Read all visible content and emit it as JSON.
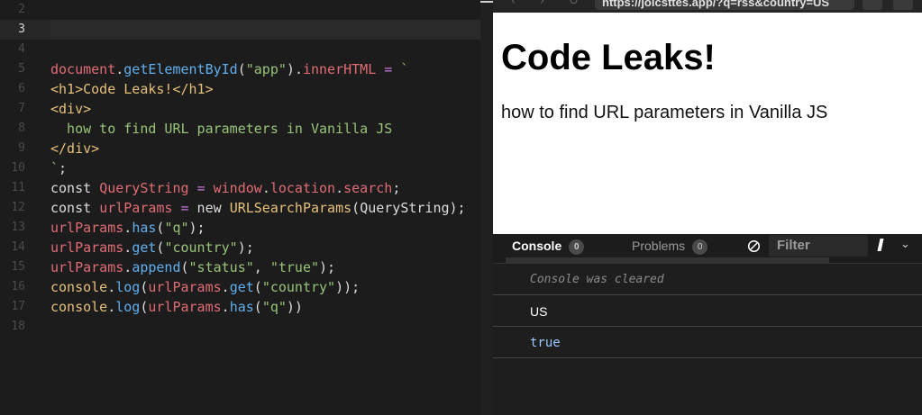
{
  "editor": {
    "lines": [
      {
        "num": "2",
        "tokens": []
      },
      {
        "num": "3",
        "tokens": [],
        "active": true
      },
      {
        "num": "4",
        "tokens": []
      },
      {
        "num": "5",
        "tokens": [
          [
            "t-obj",
            "document"
          ],
          [
            "t-dot",
            "."
          ],
          [
            "t-method",
            "getElementById"
          ],
          [
            "t-punc",
            "("
          ],
          [
            "t-str",
            "\"app\""
          ],
          [
            "t-punc",
            ")"
          ],
          [
            "t-dot",
            "."
          ],
          [
            "t-prop",
            "innerHTML"
          ],
          [
            "t-plain",
            " "
          ],
          [
            "t-op",
            "="
          ],
          [
            "t-plain",
            " "
          ],
          [
            "t-tpl",
            "`"
          ]
        ]
      },
      {
        "num": "6",
        "tokens": [
          [
            "t-tag",
            "<h1>Code Leaks!</h1>"
          ]
        ]
      },
      {
        "num": "7",
        "tokens": [
          [
            "t-tag",
            "<div>"
          ]
        ]
      },
      {
        "num": "8",
        "tokens": [
          [
            "t-tpl",
            "  how to find URL parameters in Vanilla JS"
          ]
        ]
      },
      {
        "num": "9",
        "tokens": [
          [
            "t-tag",
            "</div>"
          ]
        ]
      },
      {
        "num": "10",
        "tokens": [
          [
            "t-tpl",
            "`"
          ],
          [
            "t-punc",
            ";"
          ]
        ]
      },
      {
        "num": "11",
        "tokens": [
          [
            "t-kw",
            "const "
          ],
          [
            "t-var",
            "QueryString"
          ],
          [
            "t-plain",
            " "
          ],
          [
            "t-op",
            "="
          ],
          [
            "t-plain",
            " "
          ],
          [
            "t-obj",
            "window"
          ],
          [
            "t-dot",
            "."
          ],
          [
            "t-obj",
            "location"
          ],
          [
            "t-dot",
            "."
          ],
          [
            "t-obj",
            "search"
          ],
          [
            "t-punc",
            ";"
          ]
        ]
      },
      {
        "num": "12",
        "tokens": [
          [
            "t-kw",
            "const "
          ],
          [
            "t-var",
            "urlParams"
          ],
          [
            "t-plain",
            " "
          ],
          [
            "t-op",
            "="
          ],
          [
            "t-plain",
            " new "
          ],
          [
            "t-cls",
            "URLSearchParams"
          ],
          [
            "t-punc",
            "("
          ],
          [
            "t-plain",
            "QueryString"
          ],
          [
            "t-punc",
            ");"
          ]
        ]
      },
      {
        "num": "13",
        "tokens": [
          [
            "t-var",
            "urlParams"
          ],
          [
            "t-dot",
            "."
          ],
          [
            "t-method",
            "has"
          ],
          [
            "t-punc",
            "("
          ],
          [
            "t-str",
            "\"q\""
          ],
          [
            "t-punc",
            ");"
          ]
        ]
      },
      {
        "num": "14",
        "tokens": [
          [
            "t-var",
            "urlParams"
          ],
          [
            "t-dot",
            "."
          ],
          [
            "t-method",
            "get"
          ],
          [
            "t-punc",
            "("
          ],
          [
            "t-str",
            "\"country\""
          ],
          [
            "t-punc",
            ");"
          ]
        ]
      },
      {
        "num": "15",
        "tokens": [
          [
            "t-var",
            "urlParams"
          ],
          [
            "t-dot",
            "."
          ],
          [
            "t-method",
            "append"
          ],
          [
            "t-punc",
            "("
          ],
          [
            "t-str",
            "\"status\""
          ],
          [
            "t-punc",
            ", "
          ],
          [
            "t-str",
            "\"true\""
          ],
          [
            "t-punc",
            ");"
          ]
        ]
      },
      {
        "num": "16",
        "tokens": [
          [
            "t-con",
            "console"
          ],
          [
            "t-dot",
            "."
          ],
          [
            "t-method",
            "log"
          ],
          [
            "t-punc",
            "("
          ],
          [
            "t-var",
            "urlParams"
          ],
          [
            "t-dot",
            "."
          ],
          [
            "t-method",
            "get"
          ],
          [
            "t-punc",
            "("
          ],
          [
            "t-str",
            "\"country\""
          ],
          [
            "t-punc",
            "));"
          ]
        ]
      },
      {
        "num": "17",
        "tokens": [
          [
            "t-con",
            "console"
          ],
          [
            "t-dot",
            "."
          ],
          [
            "t-method",
            "log"
          ],
          [
            "t-punc",
            "("
          ],
          [
            "t-var",
            "urlParams"
          ],
          [
            "t-dot",
            "."
          ],
          [
            "t-method",
            "has"
          ],
          [
            "t-punc",
            "("
          ],
          [
            "t-str",
            "\"q\""
          ],
          [
            "t-punc",
            "))"
          ]
        ]
      },
      {
        "num": "18",
        "tokens": []
      }
    ]
  },
  "browser": {
    "url": "https://jolcsttes.app/?q=rss&country=US",
    "back_icon": "arrow-left-icon",
    "forward_icon": "arrow-right-icon",
    "reload_icon": "reload-icon"
  },
  "preview": {
    "heading": "Code Leaks!",
    "text": "how to find URL parameters in Vanilla JS"
  },
  "console": {
    "tabs": [
      {
        "label": "Console",
        "count": "0"
      },
      {
        "label": "Problems",
        "count": "0"
      }
    ],
    "filter_placeholder": "Filter",
    "chevron": "⌄",
    "messages": [
      {
        "text": "Console was cleared"
      },
      {
        "text": "US"
      },
      {
        "text": "true"
      }
    ]
  }
}
